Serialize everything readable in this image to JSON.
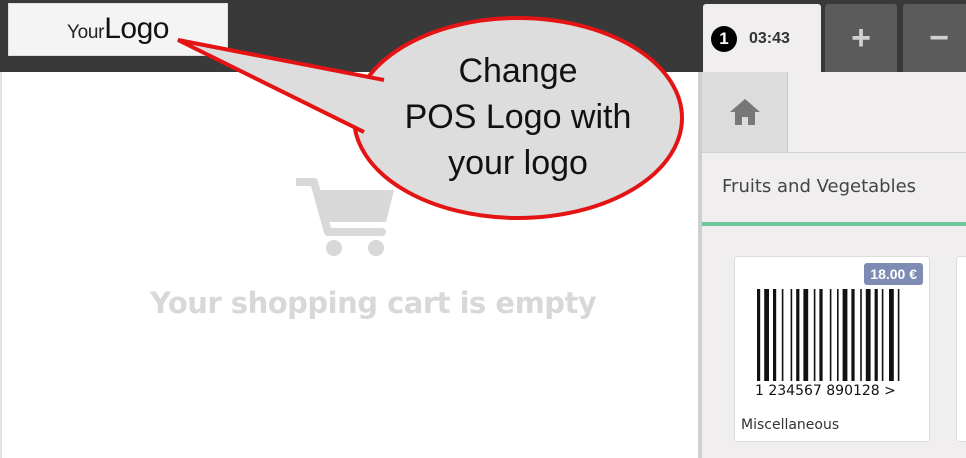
{
  "header": {
    "logo_prefix": "Your",
    "logo_main": "Logo"
  },
  "order_tab": {
    "number": "1",
    "time": "03:43"
  },
  "tab_buttons": {
    "add": "+",
    "remove": "−"
  },
  "cart": {
    "empty_message": "Your shopping cart is empty",
    "icon": "shopping-cart-icon"
  },
  "categories": {
    "home_icon": "home-icon",
    "current": "Fruits and Vegetables"
  },
  "products": [
    {
      "price": "18.00 €",
      "barcode_digits": "1  234567  890128  >",
      "name": "Miscellaneous"
    }
  ],
  "callout": {
    "lines": [
      "Change",
      "POS Logo with",
      "your logo"
    ]
  },
  "colors": {
    "topbar": "#393939",
    "accent_line": "#6ec89b",
    "price_badge": "#7e8cb4",
    "callout_border": "#e41414",
    "callout_fill": "#dddddd"
  }
}
